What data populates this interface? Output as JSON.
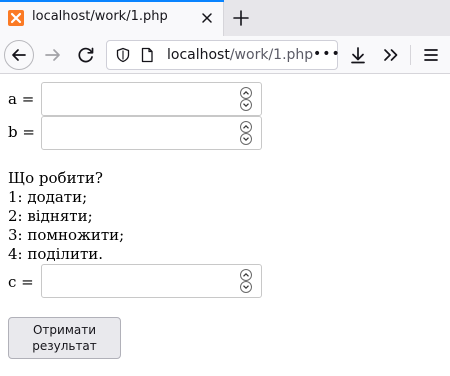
{
  "browser": {
    "tab": {
      "title": "localhost/work/1.php",
      "favicon": "xampp-icon"
    },
    "url": {
      "host": "localhost",
      "path": "/work/1.php",
      "more": "•••"
    },
    "accent_color": "#0a84ff"
  },
  "form": {
    "a": {
      "label": "a =",
      "value": "",
      "placeholder": ""
    },
    "b": {
      "label": "b =",
      "value": "",
      "placeholder": ""
    },
    "question": "Що робити?",
    "options": [
      "1: додати;",
      "2: відняти;",
      "3: помножити;",
      "4: поділити."
    ],
    "c": {
      "label": "c =",
      "value": "",
      "placeholder": ""
    },
    "submit_label_line1": "Отримати",
    "submit_label_line2": "результат"
  }
}
